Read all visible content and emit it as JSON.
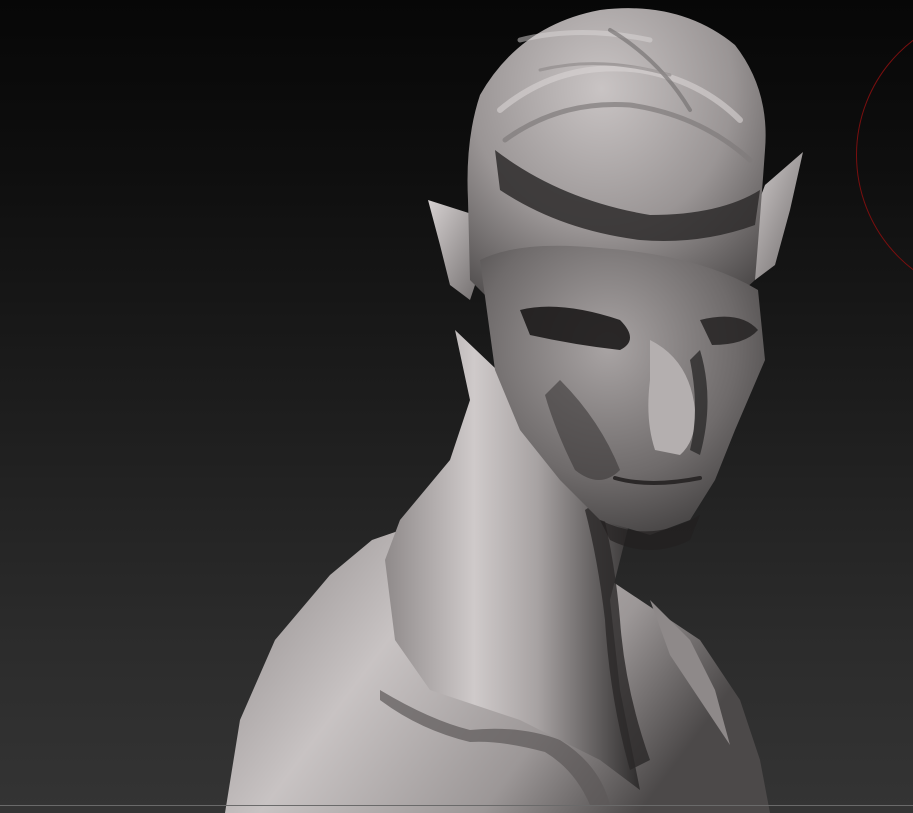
{
  "app": {
    "window_title": "",
    "status_text": ""
  },
  "viewport": {
    "model": "sculpted-bust",
    "brush_cursor_color": "#7a0f0f",
    "background_top": "#070707",
    "background_bottom": "#343434",
    "material_color": "#b8b3b3"
  }
}
